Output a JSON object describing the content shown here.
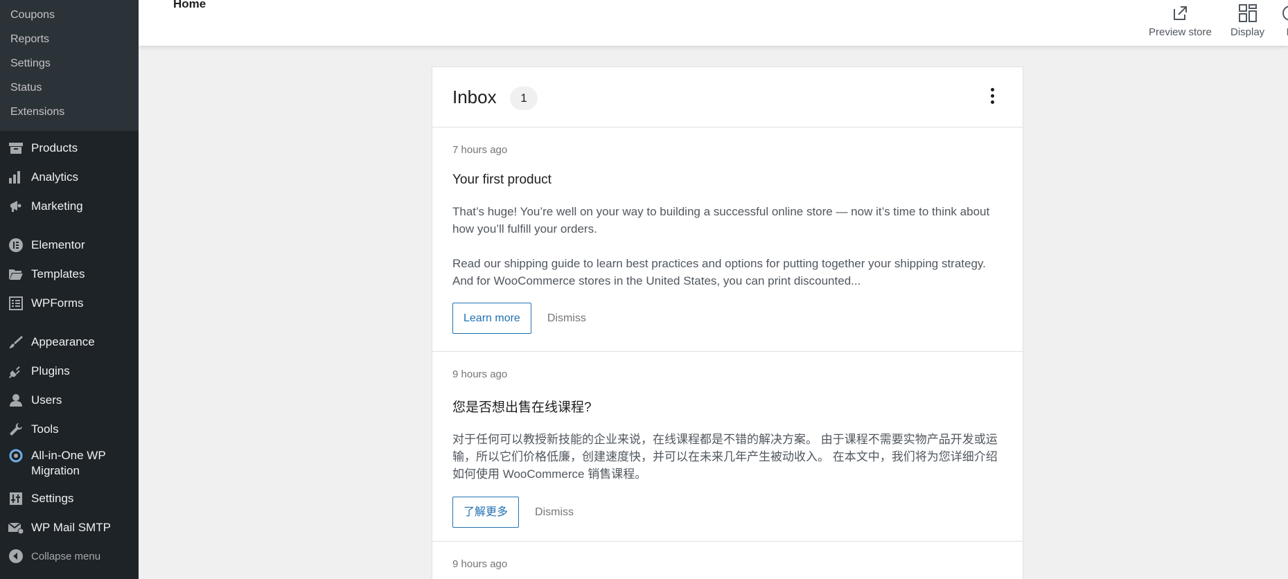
{
  "sidebar": {
    "submenu": [
      "Coupons",
      "Reports",
      "Settings",
      "Status",
      "Extensions"
    ],
    "group1": [
      {
        "label": "Products",
        "icon": "archive-icon"
      },
      {
        "label": "Analytics",
        "icon": "bar-chart-icon"
      },
      {
        "label": "Marketing",
        "icon": "megaphone-icon"
      }
    ],
    "group2": [
      {
        "label": "Elementor",
        "icon": "elementor-icon"
      },
      {
        "label": "Templates",
        "icon": "folder-icon"
      },
      {
        "label": "WPForms",
        "icon": "form-icon"
      }
    ],
    "group3": [
      {
        "label": "Appearance",
        "icon": "paintbrush-icon"
      },
      {
        "label": "Plugins",
        "icon": "plug-icon"
      },
      {
        "label": "Users",
        "icon": "user-icon"
      },
      {
        "label": "Tools",
        "icon": "wrench-icon"
      },
      {
        "label": "All-in-One WP Migration",
        "icon": "migration-icon"
      },
      {
        "label": "Settings",
        "icon": "sliders-icon"
      },
      {
        "label": "WP Mail SMTP",
        "icon": "mail-icon"
      }
    ],
    "collapse_label": "Collapse menu"
  },
  "header": {
    "title": "Home",
    "preview_label": "Preview store",
    "display_label": "Display",
    "help_label": "H"
  },
  "inbox": {
    "title": "Inbox",
    "count": "1",
    "notes": [
      {
        "time": "7 hours ago",
        "title": "Your first product",
        "body1": "That’s huge! You’re well on your way to building a successful online store — now it’s time to think about how you’ll fulfill your orders.",
        "body2": "Read our shipping guide to learn best practices and options for putting together your shipping strategy. And for WooCommerce stores in the United States, you can print discounted...",
        "action": "Learn more",
        "dismiss": "Dismiss"
      },
      {
        "time": "9 hours ago",
        "title": "您是否想出售在线课程?",
        "body1": "对于任何可以教授新技能的企业来说，在线课程都是不错的解决方案。 由于课程不需要实物产品开发或运输，所以它们价格低廉，创建速度快，并可以在未来几年产生被动收入。 在本文中，我们将为您详细介绍如何使用 WooCommerce 销售课程。",
        "action": "了解更多",
        "dismiss": "Dismiss"
      },
      {
        "time": "9 hours ago"
      }
    ]
  },
  "colors": {
    "sidebar_bg": "#1d2327",
    "submenu_bg": "#2c3338",
    "accent": "#2271b1",
    "page_bg": "#f0f0f1"
  }
}
